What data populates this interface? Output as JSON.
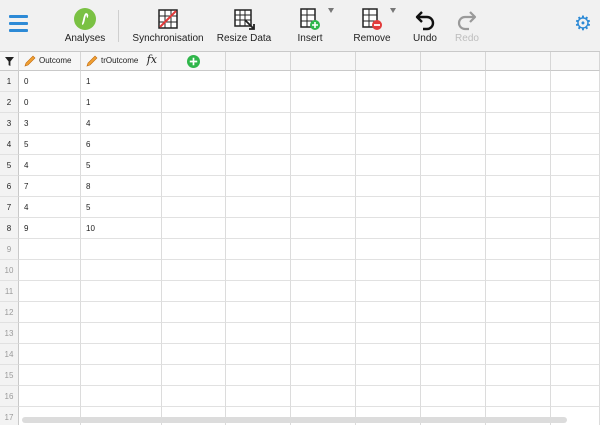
{
  "toolbar": {
    "analyses": "Analyses",
    "synchronisation": "Synchronisation",
    "resize": "Resize Data",
    "insert": "Insert",
    "remove": "Remove",
    "undo": "Undo",
    "redo": "Redo"
  },
  "columns": [
    {
      "name": "Outcome",
      "computed": false
    },
    {
      "name": "trOutcome",
      "computed": true
    }
  ],
  "rows": [
    {
      "n": "1",
      "c1": "0",
      "c2": "1"
    },
    {
      "n": "2",
      "c1": "0",
      "c2": "1"
    },
    {
      "n": "3",
      "c1": "3",
      "c2": "4"
    },
    {
      "n": "4",
      "c1": "5",
      "c2": "6"
    },
    {
      "n": "5",
      "c1": "4",
      "c2": "5"
    },
    {
      "n": "6",
      "c1": "7",
      "c2": "8"
    },
    {
      "n": "7",
      "c1": "4",
      "c2": "5"
    },
    {
      "n": "8",
      "c1": "9",
      "c2": "10"
    },
    {
      "n": "9",
      "c1": "",
      "c2": ""
    },
    {
      "n": "10",
      "c1": "",
      "c2": ""
    },
    {
      "n": "11",
      "c1": "",
      "c2": ""
    },
    {
      "n": "12",
      "c1": "",
      "c2": ""
    },
    {
      "n": "13",
      "c1": "",
      "c2": ""
    },
    {
      "n": "14",
      "c1": "",
      "c2": ""
    },
    {
      "n": "15",
      "c1": "",
      "c2": ""
    },
    {
      "n": "16",
      "c1": "",
      "c2": ""
    },
    {
      "n": "17",
      "c1": "",
      "c2": ""
    }
  ],
  "colors": {
    "accent": "#2d8ad6",
    "analyses": "#7ac143",
    "add": "#2fb64a"
  }
}
